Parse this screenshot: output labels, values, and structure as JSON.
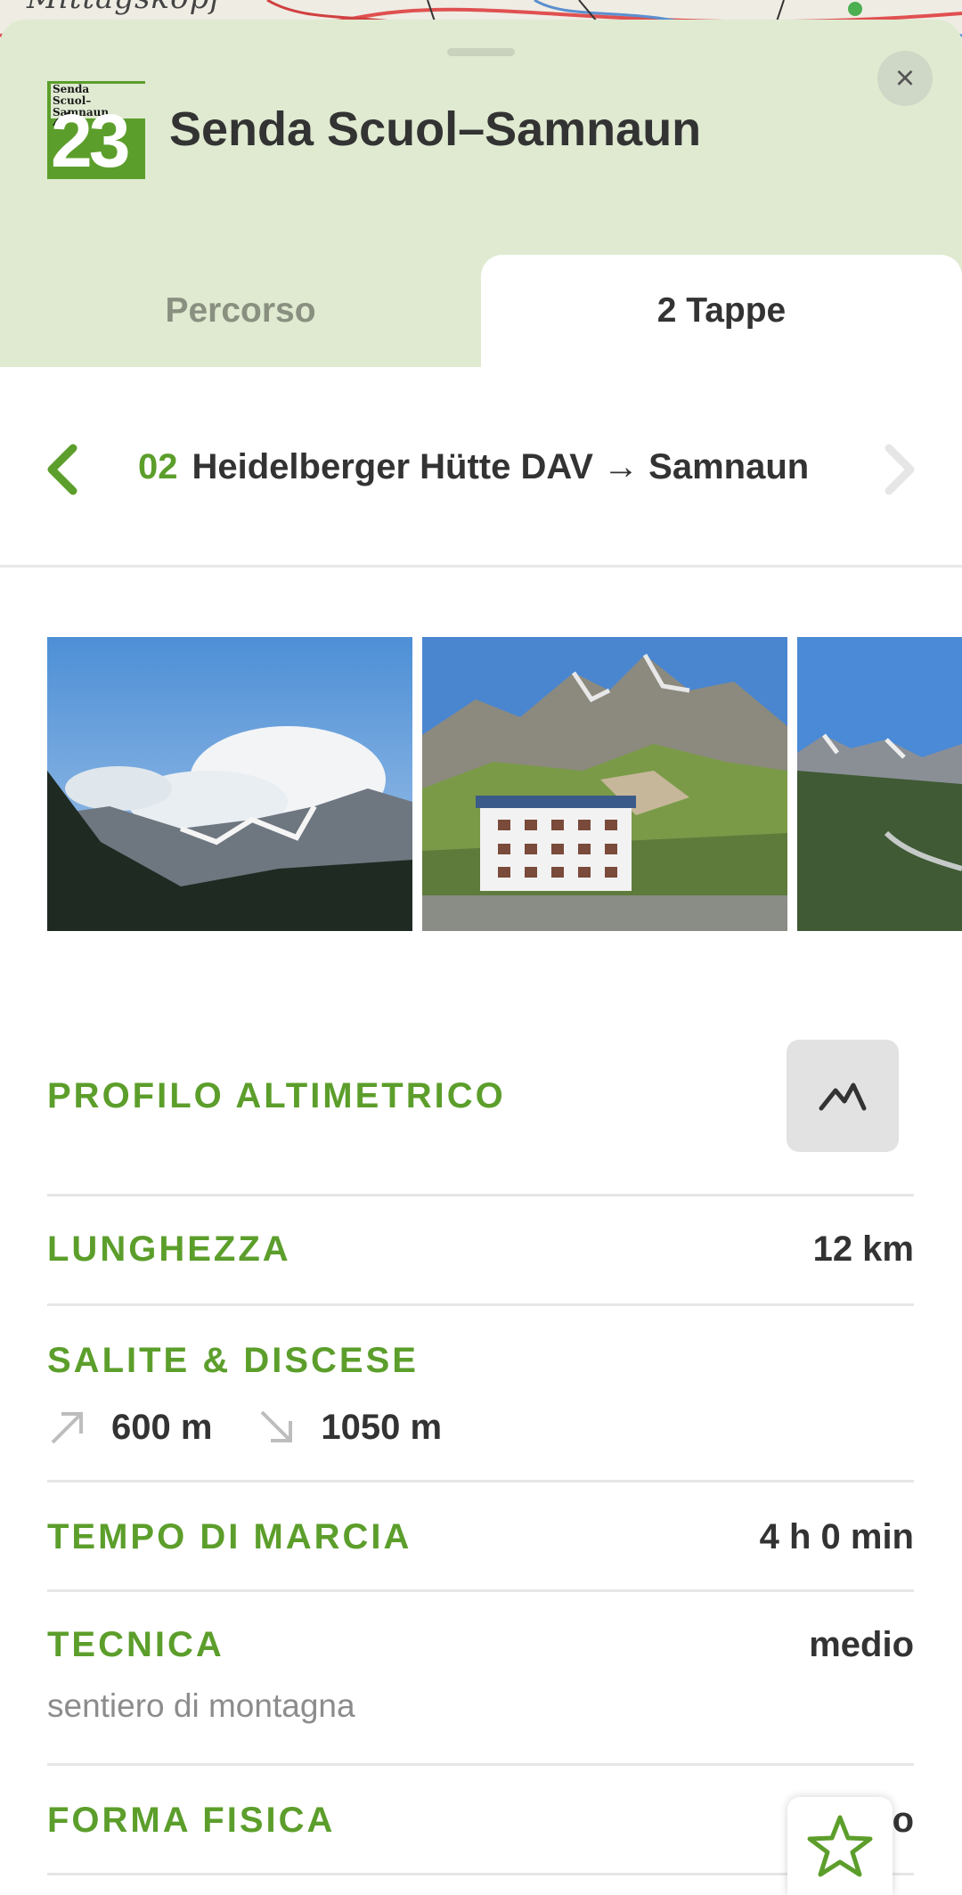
{
  "map": {
    "place_label": "Mittagskopf"
  },
  "header": {
    "logo": {
      "line1": "Senda",
      "line2": "Scuol–Samnaun",
      "number": "23"
    },
    "title": "Senda Scuol–Samnaun",
    "close_icon": "close-icon"
  },
  "tabs": [
    {
      "label": "Percorso",
      "active": false
    },
    {
      "label": "2 Tappe",
      "active": true
    }
  ],
  "stage": {
    "number": "02",
    "name": "Heidelberger Hütte DAV → Samnaun"
  },
  "gallery": {
    "photos": [
      {
        "subject": "mountain-clouds"
      },
      {
        "subject": "mountain-hut"
      },
      {
        "subject": "valley-road"
      }
    ]
  },
  "details": {
    "profile": {
      "label": "PROFILO ALTIMETRICO",
      "icon": "elevation-profile-icon"
    },
    "length": {
      "label": "LUNGHEZZA",
      "value": "12 km"
    },
    "ascent_descent": {
      "label": "SALITE & DISCESE",
      "ascent": "600 m",
      "descent": "1050 m"
    },
    "walking_time": {
      "label": "TEMPO DI MARCIA",
      "value": "4 h 0 min"
    },
    "technique": {
      "label": "TECNICA",
      "value": "medio",
      "sub": "sentiero di montagna"
    },
    "fitness": {
      "label": "FORMA FISICA",
      "value": "medio"
    }
  },
  "favorite": {
    "icon": "star-icon"
  },
  "colors": {
    "accent": "#5c9e2b",
    "header_bg": "#dfead1",
    "text": "#333333",
    "muted": "#8c8c8c"
  }
}
